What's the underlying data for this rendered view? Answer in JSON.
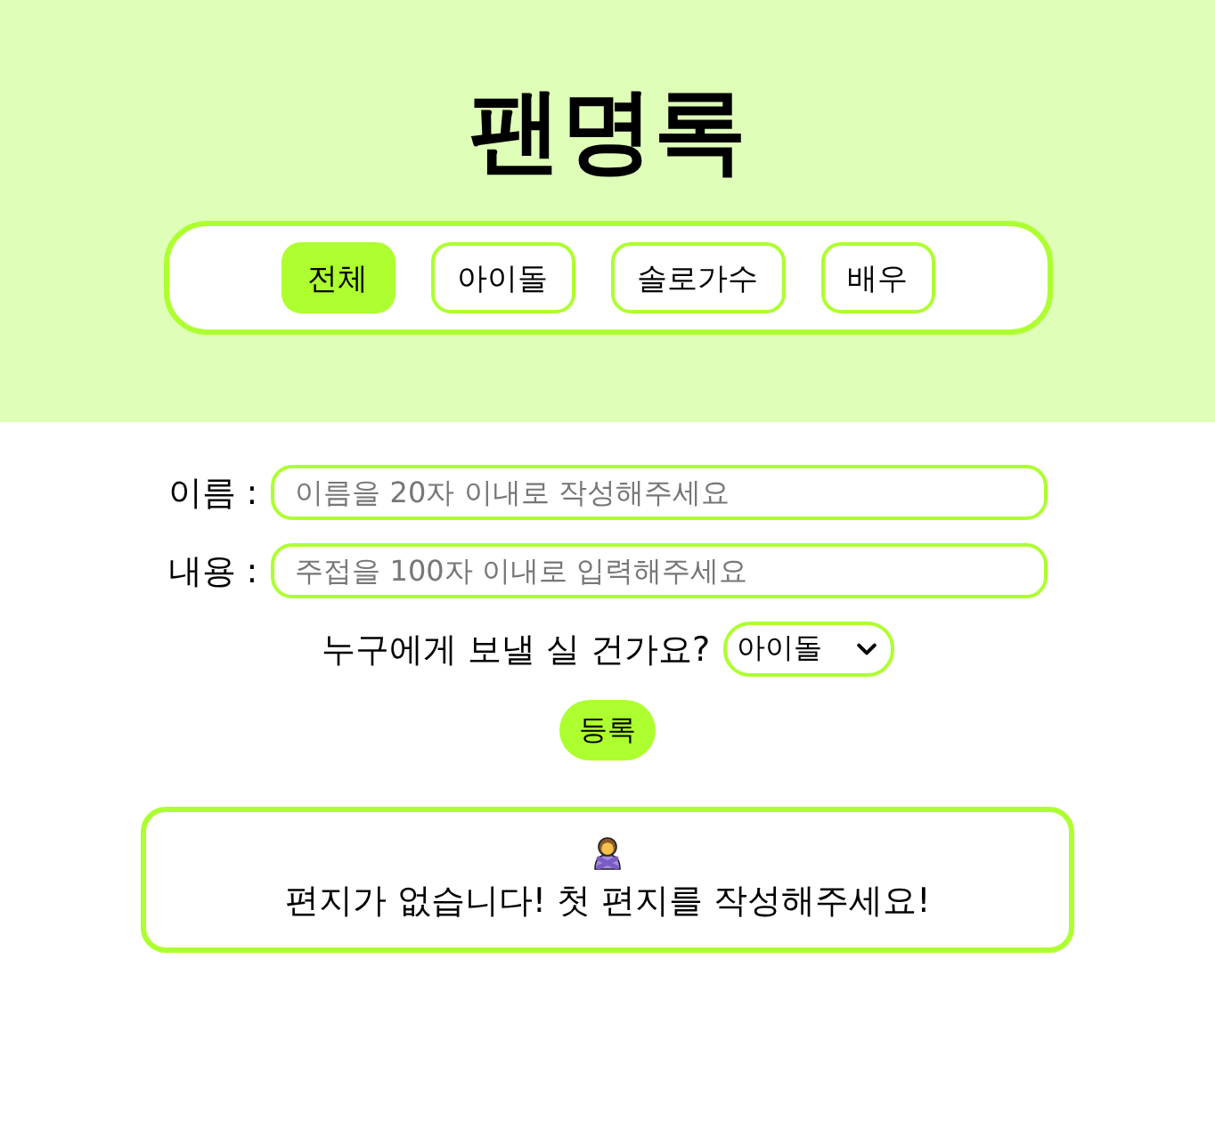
{
  "header": {
    "title": "팬명록",
    "tabs": [
      {
        "label": "전체",
        "selected": true
      },
      {
        "label": "아이돌",
        "selected": false
      },
      {
        "label": "솔로가수",
        "selected": false
      },
      {
        "label": "배우",
        "selected": false
      }
    ]
  },
  "form": {
    "fields": [
      {
        "label": "이름 :",
        "placeholder": "이름을 20자 이내로 작성해주세요"
      },
      {
        "label": "내용 :",
        "placeholder": "주접을 100자 이내로 입력해주세요"
      }
    ],
    "recipient": {
      "label": "누구에게 보낼 실 건가요?",
      "value": "아이돌"
    },
    "submit": "등록"
  },
  "letters": {
    "empty_message": "편지가 없습니다! 첫 편지를 작성해주세요!"
  }
}
